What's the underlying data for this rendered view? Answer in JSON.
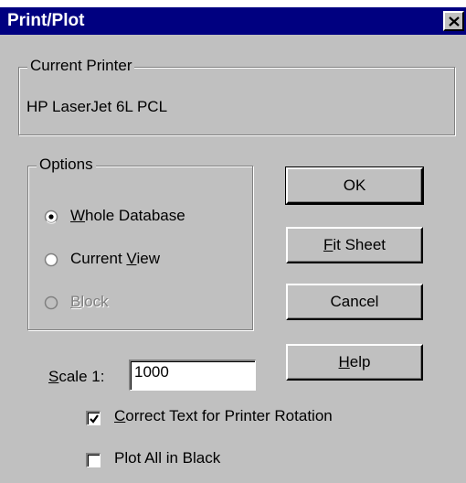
{
  "window": {
    "title": "Print/Plot"
  },
  "current_printer": {
    "legend": "Current Printer",
    "value": "HP LaserJet 6L PCL"
  },
  "options": {
    "legend": "Options",
    "items": [
      {
        "pre": "",
        "key": "W",
        "post": "hole Database",
        "selected": true,
        "enabled": true
      },
      {
        "pre": "Current ",
        "key": "V",
        "post": "iew",
        "selected": false,
        "enabled": true
      },
      {
        "pre": "",
        "key": "B",
        "post": "lock",
        "selected": false,
        "enabled": false
      }
    ]
  },
  "buttons": {
    "ok": {
      "label": "OK"
    },
    "fit_sheet": {
      "key": "F",
      "rest": "it Sheet"
    },
    "cancel": {
      "label": "Cancel"
    },
    "help": {
      "key": "H",
      "rest": "elp"
    }
  },
  "scale": {
    "key": "S",
    "rest": "cale 1:",
    "value": "1000"
  },
  "checkboxes": {
    "correct_text": {
      "key": "C",
      "rest": "orrect Text for Printer Rotation",
      "checked": true
    },
    "plot_black": {
      "pre": "Plot All in Black",
      "checked": false
    }
  },
  "colors": {
    "titlebar": "#000080",
    "face": "#c0c0c0",
    "shadow": "#808080",
    "highlight": "#ffffff"
  }
}
